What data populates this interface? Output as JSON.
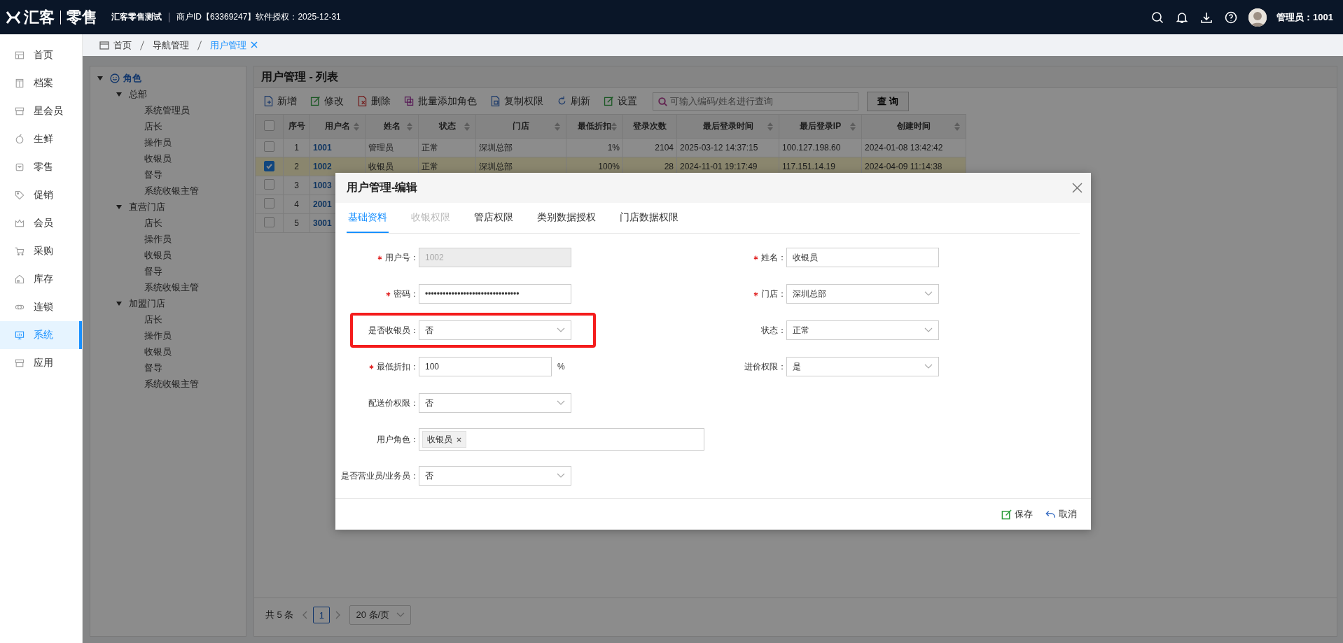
{
  "top_bar": {
    "logo_brand": "汇客",
    "logo_product": "零售",
    "company": "汇客零售测试",
    "merchant_info": "商户ID【63369247】软件授权：2025-12-31",
    "user": "管理员：1001"
  },
  "sidebar": {
    "items": [
      {
        "label": "首页",
        "selected": false
      },
      {
        "label": "档案",
        "selected": false
      },
      {
        "label": "星会员",
        "selected": false
      },
      {
        "label": "生鲜",
        "selected": false
      },
      {
        "label": "零售",
        "selected": false
      },
      {
        "label": "促销",
        "selected": false
      },
      {
        "label": "会员",
        "selected": false
      },
      {
        "label": "采购",
        "selected": false
      },
      {
        "label": "库存",
        "selected": false
      },
      {
        "label": "连锁",
        "selected": false
      },
      {
        "label": "系统",
        "selected": true
      },
      {
        "label": "应用",
        "selected": false
      }
    ]
  },
  "breadcrumb": [
    {
      "label": "首页",
      "selected": false
    },
    {
      "label": "导航管理",
      "selected": false
    },
    {
      "label": "用户管理",
      "selected": true
    }
  ],
  "role_tree": {
    "label": "角色",
    "expanded": true,
    "children": [
      {
        "label": "总部",
        "expanded": true,
        "children": [
          {
            "label": "系统管理员"
          },
          {
            "label": "店长"
          },
          {
            "label": "操作员"
          },
          {
            "label": "收银员"
          },
          {
            "label": "督导"
          },
          {
            "label": "系统收银主管"
          }
        ]
      },
      {
        "label": "直营门店",
        "expanded": true,
        "children": [
          {
            "label": "店长"
          },
          {
            "label": "操作员"
          },
          {
            "label": "收银员"
          },
          {
            "label": "督导"
          },
          {
            "label": "系统收银主管"
          }
        ]
      },
      {
        "label": "加盟门店",
        "expanded": true,
        "children": [
          {
            "label": "店长"
          },
          {
            "label": "操作员"
          },
          {
            "label": "收银员"
          },
          {
            "label": "督导"
          },
          {
            "label": "系统收银主管"
          }
        ]
      }
    ]
  },
  "list_panel": {
    "title": "用户管理 - 列表",
    "toolbar": [
      "新增",
      "修改",
      "删除",
      "批量添加角色",
      "复制权限",
      "刷新",
      "设置"
    ],
    "search": {
      "placeholder": "可输入编码/姓名进行查询"
    },
    "query_button": "查 询",
    "table": {
      "select_all_checked": false,
      "columns": [
        {
          "label": "序号",
          "sortable": false
        },
        {
          "label": "用户名",
          "sortable": true
        },
        {
          "label": "姓名",
          "sortable": true
        },
        {
          "label": "状态",
          "sortable": true
        },
        {
          "label": "门店",
          "sortable": true
        },
        {
          "label": "最低折扣",
          "sortable": true
        },
        {
          "label": "登录次数",
          "sortable": false
        },
        {
          "label": "最后登录时间",
          "sortable": true
        },
        {
          "label": "最后登录IP",
          "sortable": true
        },
        {
          "label": "创建时间",
          "sortable": true
        }
      ],
      "rows": [
        {
          "selected": false,
          "cells": [
            "1",
            "1001",
            "管理员",
            "正常",
            "深圳总部",
            "1%",
            "2104",
            "2025-03-12 14:37:15",
            "100.127.198.60",
            "2024-01-08 13:42:42"
          ]
        },
        {
          "selected": true,
          "cells": [
            "2",
            "1002",
            "收银员",
            "正常",
            "深圳总部",
            "100%",
            "28",
            "2024-11-01 19:17:49",
            "117.151.14.19",
            "2024-04-09 11:14:38"
          ]
        },
        {
          "selected": false,
          "cells": [
            "3",
            "1003"
          ]
        },
        {
          "selected": false,
          "cells": [
            "4",
            "2001"
          ]
        },
        {
          "selected": false,
          "cells": [
            "5",
            "3001"
          ]
        }
      ]
    },
    "pagination": {
      "total": "共 5 条",
      "current_page": "1",
      "page_size": "20 条/页"
    }
  },
  "dialog": {
    "title": "用户管理-编辑",
    "tabs": [
      {
        "label": "基础资料",
        "selected": true,
        "disabled": false
      },
      {
        "label": "收银权限",
        "selected": false,
        "disabled": true
      },
      {
        "label": "管店权限",
        "selected": false,
        "disabled": false
      },
      {
        "label": "类别数据授权",
        "selected": false,
        "disabled": false
      },
      {
        "label": "门店数据权限",
        "selected": false,
        "disabled": false
      }
    ],
    "rows": [
      [
        {
          "label": "用户号：",
          "kind": "text",
          "required": true,
          "disabled": true,
          "highlighted": false,
          "value": "1002"
        },
        {
          "label": "姓名：",
          "kind": "text",
          "required": true,
          "disabled": false,
          "highlighted": false,
          "value": "收银员"
        }
      ],
      [
        {
          "label": "密码：",
          "kind": "text",
          "required": true,
          "disabled": false,
          "highlighted": false,
          "value": "••••••••••••••••••••••••••••••••"
        },
        {
          "label": "门店：",
          "kind": "select",
          "required": true,
          "disabled": false,
          "highlighted": false,
          "value": "深圳总部"
        }
      ],
      [
        {
          "label": "是否收银员：",
          "kind": "select",
          "required": false,
          "disabled": false,
          "highlighted": true,
          "value": "否"
        },
        {
          "label": "状态：",
          "kind": "select",
          "required": false,
          "disabled": false,
          "highlighted": false,
          "value": "正常"
        }
      ],
      [
        {
          "label": "最低折扣：",
          "kind": "text",
          "required": true,
          "disabled": false,
          "highlighted": false,
          "value": "100",
          "suffix": "%"
        },
        {
          "label": "进价权限：",
          "kind": "select",
          "required": false,
          "disabled": false,
          "highlighted": false,
          "value": "是"
        }
      ],
      [
        {
          "label": "配送价权限：",
          "kind": "select",
          "required": false,
          "disabled": false,
          "highlighted": false,
          "value": "否"
        }
      ],
      [
        {
          "label": "用户角色：",
          "kind": "tags",
          "required": false,
          "disabled": false,
          "highlighted": false,
          "tags": [
            "收银员"
          ]
        }
      ],
      [
        {
          "label": "是否营业员/业务员：",
          "kind": "select",
          "required": false,
          "disabled": false,
          "highlighted": false,
          "value": "否"
        }
      ]
    ],
    "buttons": [
      "保存",
      "取消"
    ]
  }
}
